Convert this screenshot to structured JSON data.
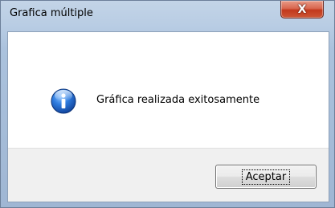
{
  "window": {
    "title": "Grafica múltiple",
    "close_icon": "close-icon",
    "close_glyph": "X"
  },
  "message": {
    "icon": "info-icon",
    "text": "Gráfica realizada exitosamente"
  },
  "buttons": {
    "ok_label": "Aceptar"
  },
  "colors": {
    "frame": "#b9cde4",
    "close_button": "#c2391d",
    "info_icon": "#1f5fbf",
    "button_bar": "#f0f0f0"
  }
}
